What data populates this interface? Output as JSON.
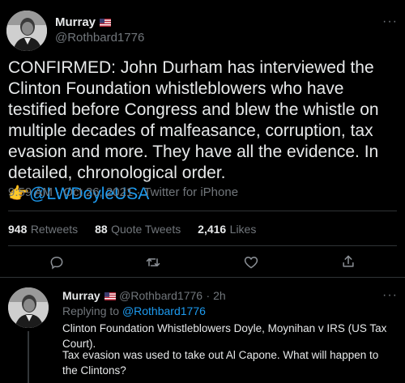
{
  "main_tweet": {
    "author_name": "Murray",
    "author_handle": "@Rothbard1776",
    "more_label": "···",
    "text": "CONFIRMED: John Durham has interviewed the Clinton Foundation whistleblowers who have testified before Congress and blew the whistle on multiple decades of malfeasance, corruption, tax evasion and more. They have all the evidence. In detailed, chronological order.",
    "pointer_emoji": "👉",
    "mention": "@LWDoyleUSA",
    "timestamp": "9:59 AM · Oct 26, 2021 · Twitter for iPhone"
  },
  "stats": {
    "retweets_count": "948",
    "retweets_label": "Retweets",
    "quotes_count": "88",
    "quotes_label": "Quote Tweets",
    "likes_count": "2,416",
    "likes_label": "Likes"
  },
  "actions": [
    "reply-icon",
    "retweet-icon",
    "like-icon",
    "share-icon"
  ],
  "reply": {
    "author_name": "Murray",
    "author_handle": "@Rothbard1776",
    "time": "· 2h",
    "more_label": "···",
    "replying_prefix": "Replying to",
    "replying_to": "@Rothbard1776",
    "line1": "Clinton Foundation Whistleblowers Doyle, Moynihan v IRS (US Tax Court).",
    "line2": "Tax evasion was used to take out Al Capone. What will happen to the Clintons?"
  },
  "colors": {
    "background": "#000000",
    "text": "#e7e9ea",
    "muted": "#71767b",
    "link": "#1d9bf0"
  }
}
